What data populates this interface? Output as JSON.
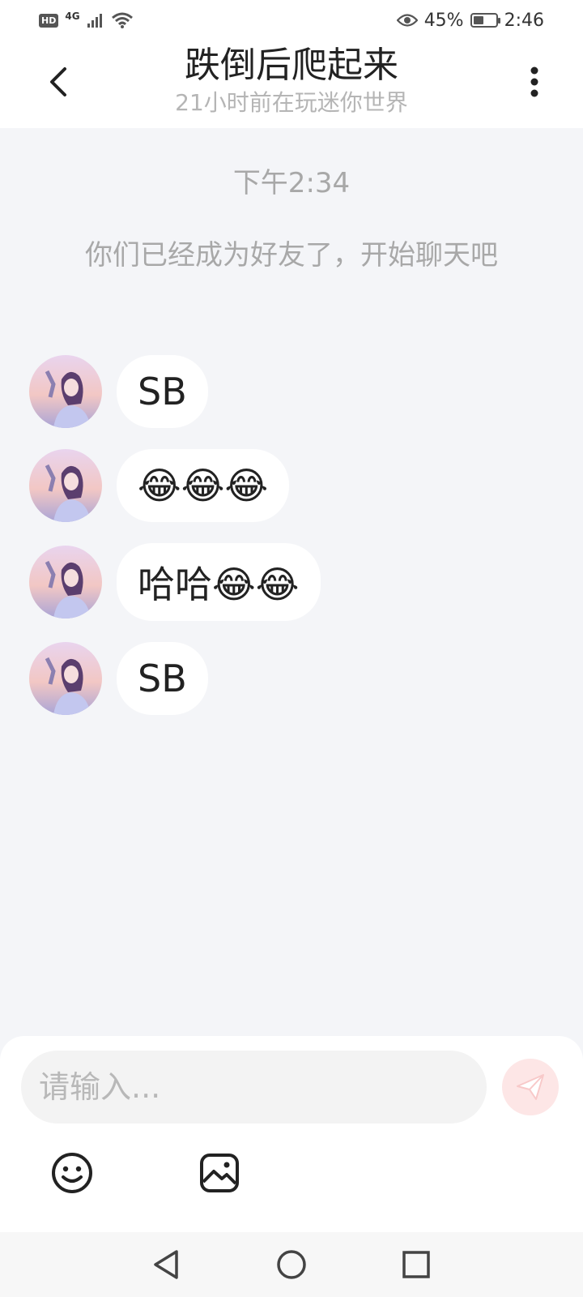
{
  "status_bar": {
    "hd": "HD",
    "network": "4G",
    "battery_percent": "45%",
    "battery_level": 0.45,
    "time": "2:46",
    "icons": [
      "signal-icon",
      "wifi-icon",
      "eye-icon",
      "battery-icon"
    ]
  },
  "header": {
    "title": "跌倒后爬起来",
    "subtitle": "21小时前在玩迷你世界",
    "back_icon": "back-icon",
    "more_icon": "more-vertical-icon"
  },
  "chat": {
    "timestamp": "下午2:34",
    "system_message": "你们已经成为好友了，开始聊天吧",
    "messages": [
      {
        "text": "SB"
      },
      {
        "text": "😂😂😂"
      },
      {
        "text": "哈哈😂😂"
      },
      {
        "text": "SB"
      }
    ]
  },
  "composer": {
    "placeholder": "请输入...",
    "send_icon": "send-icon",
    "emoji_icon": "emoji-icon",
    "image_icon": "image-icon"
  },
  "nav": {
    "icons": [
      "back-triangle-icon",
      "home-circle-icon",
      "recents-square-icon"
    ]
  },
  "colors": {
    "background": "#f4f5f8",
    "bubble": "#ffffff",
    "send_button": "#fde6e6",
    "hint_text": "#a8a8a8"
  }
}
